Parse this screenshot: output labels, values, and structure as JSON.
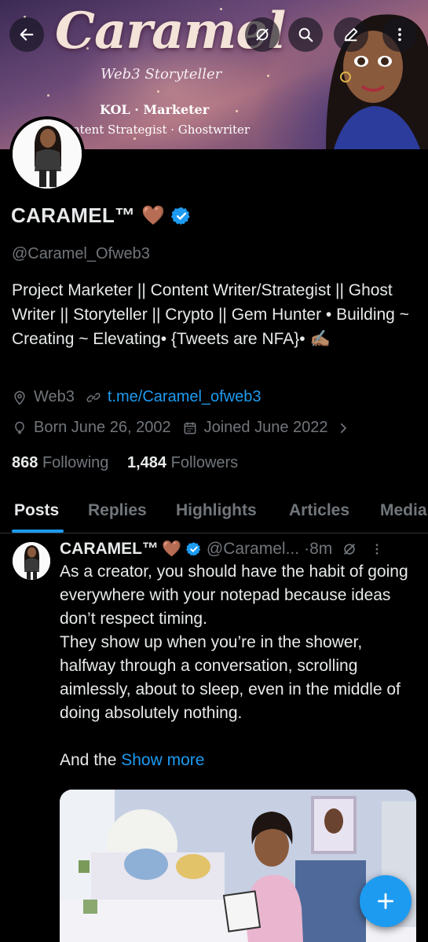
{
  "banner": {
    "title": "Caramel",
    "subtitle": "Web3 Storyteller",
    "line1": "KOL · Marketer",
    "line2": "ntent Strategist · Ghostwriter"
  },
  "top_bar": {
    "icons": [
      "back-arrow-icon",
      "grok-icon",
      "search-icon",
      "edit-icon",
      "more-icon"
    ]
  },
  "profile": {
    "name": "CARAMEL™",
    "emoji": "🤎",
    "verified": true,
    "handle": "@Caramel_Ofweb3",
    "bio": "Project Marketer || Content Writer/Strategist || Ghost Writer || Storyteller || Crypto || Gem Hunter • Building ~ Creating ~ Elevating• {Tweets are NFA}• ✍🏽",
    "location": "Web3",
    "link": "t.me/Caramel_ofweb3",
    "born": "Born June 26, 2002",
    "joined": "Joined June 2022",
    "following_count": "868",
    "following_label": "Following",
    "followers_count": "1,484",
    "followers_label": "Followers"
  },
  "tabs": [
    "Posts",
    "Replies",
    "Highlights",
    "Articles",
    "Media"
  ],
  "active_tab": "Posts",
  "post": {
    "name": "CARAMEL™",
    "emoji": "🤎",
    "handle": "@Caramel...",
    "time": "·8m",
    "text": "As a creator, you should have the habit of going everywhere with your notepad because ideas don’t respect timing.\nThey show up when you’re in the shower, halfway through a conversation, scrolling aimlessly, about to sleep, even in the middle of doing absolutely nothing.\n\nAnd the ",
    "show_more": "Show more"
  },
  "colors": {
    "accent": "#1d9bf0",
    "background": "#000000",
    "text": "#e7e9ea",
    "muted": "#71767b"
  }
}
